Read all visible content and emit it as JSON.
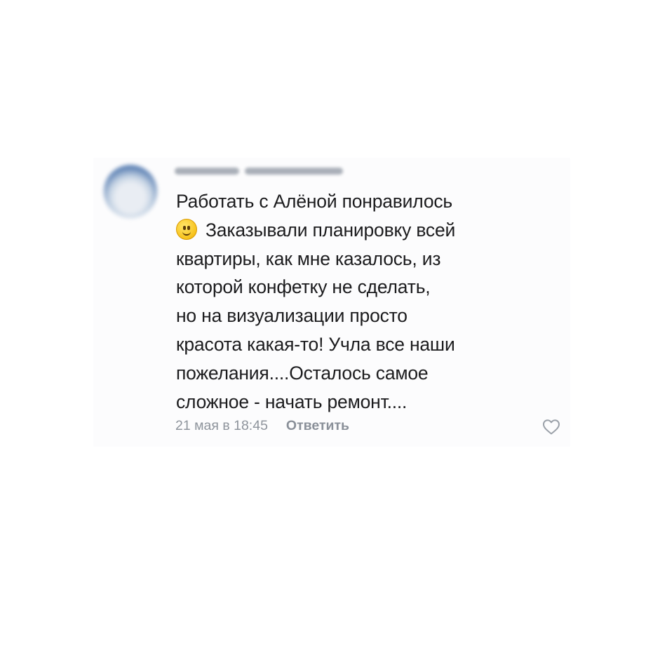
{
  "comment": {
    "author_name": "",
    "lines": [
      "Работать с Алёной понравилось",
      "Заказывали планировку всей",
      "квартиры, как мне казалось, из",
      "которой конфетку не сделать,",
      "но на визуализации просто",
      "красота какая-то! Учла все наши",
      "пожелания....Осталось самое",
      "сложное - начать ремонт...."
    ],
    "emoji": "slightly-smiling-face-icon",
    "timestamp": "21 мая в 18:45",
    "reply_label": "Ответить",
    "like_icon": "heart-icon"
  },
  "colors": {
    "text": "#1c1c1e",
    "meta": "#8e949c",
    "heart": "#9aa0a8"
  }
}
